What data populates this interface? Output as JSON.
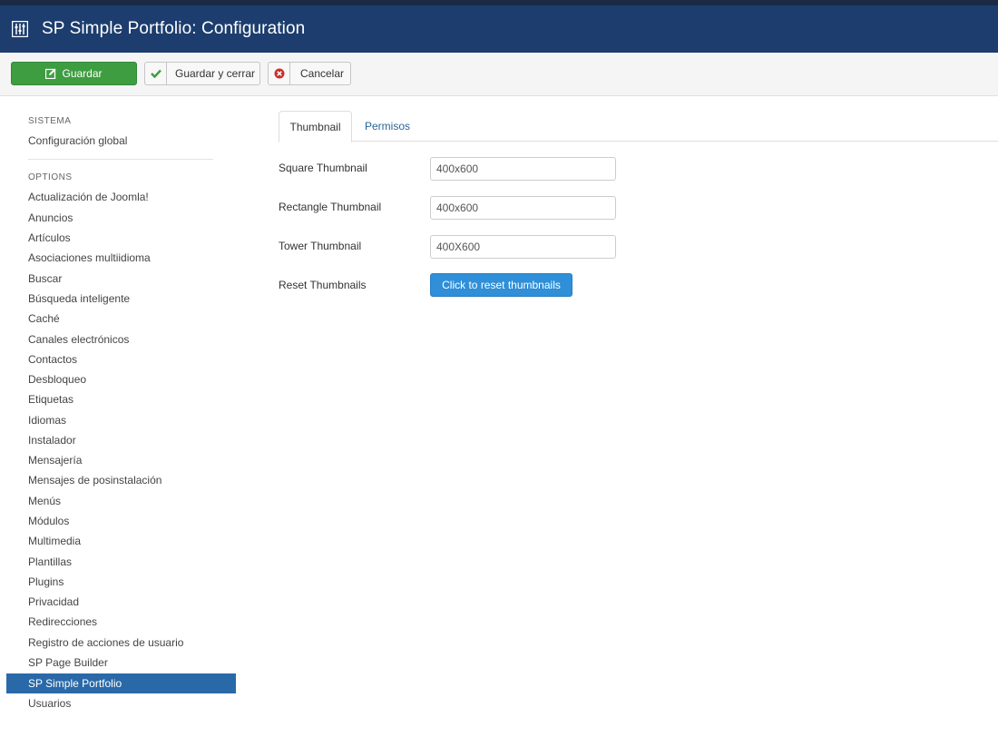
{
  "header": {
    "title": "SP Simple Portfolio: Configuration"
  },
  "toolbar": {
    "save_label": "Guardar",
    "save_close_label": "Guardar y cerrar",
    "cancel_label": "Cancelar"
  },
  "sidebar": {
    "system_heading": "SISTEMA",
    "global_config": "Configuración global",
    "options_heading": "OPTIONS",
    "items": [
      "Actualización de Joomla!",
      "Anuncios",
      "Artículos",
      "Asociaciones multiidioma",
      "Buscar",
      "Búsqueda inteligente",
      "Caché",
      "Canales electrónicos",
      "Contactos",
      "Desbloqueo",
      "Etiquetas",
      "Idiomas",
      "Instalador",
      "Mensajería",
      "Mensajes de posinstalación",
      "Menús",
      "Módulos",
      "Multimedia",
      "Plantillas",
      "Plugins",
      "Privacidad",
      "Redirecciones",
      "Registro de acciones de usuario",
      "SP Page Builder",
      "SP Simple Portfolio",
      "Usuarios"
    ],
    "active_item": "SP Simple Portfolio"
  },
  "tabs": [
    {
      "label": "Thumbnail",
      "active": true
    },
    {
      "label": "Permisos",
      "active": false
    }
  ],
  "form": {
    "square_label": "Square Thumbnail",
    "square_value": "400x600",
    "rectangle_label": "Rectangle Thumbnail",
    "rectangle_value": "400x600",
    "tower_label": "Tower Thumbnail",
    "tower_value": "400X600",
    "reset_label": "Reset Thumbnails",
    "reset_button": "Click to reset thumbnails"
  },
  "colors": {
    "header_bg": "#1c3d6e",
    "save_green": "#3e9d40",
    "active_blue": "#2a69a8",
    "reset_blue": "#2f8fd8"
  }
}
